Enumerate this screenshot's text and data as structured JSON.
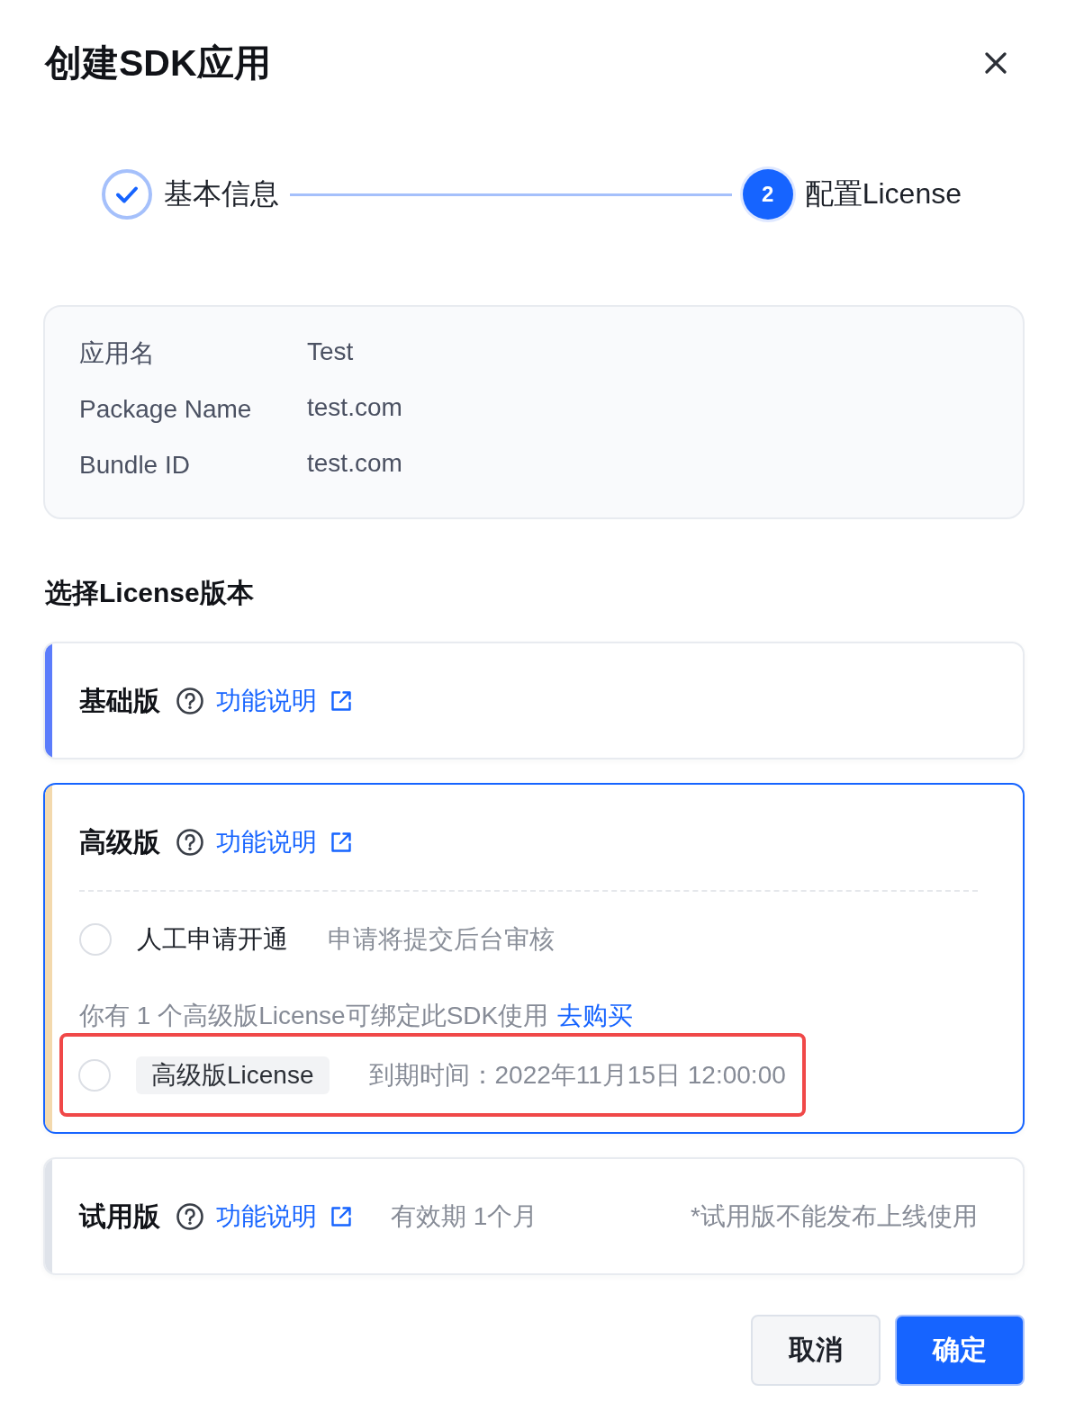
{
  "dialog": {
    "title": "创建SDK应用"
  },
  "steps": [
    {
      "label": "基本信息",
      "completed": true
    },
    {
      "label": "配置License",
      "number": "2",
      "completed": false
    }
  ],
  "app_info": [
    {
      "label": "应用名",
      "value": "Test"
    },
    {
      "label": "Package Name",
      "value": "test.com"
    },
    {
      "label": "Bundle ID",
      "value": "test.com"
    }
  ],
  "license_section": {
    "title": "选择License版本",
    "editions": [
      {
        "name": "基础版",
        "link": "功能说明",
        "color": "#5b7cfb",
        "selected": false
      },
      {
        "name": "高级版",
        "link": "功能说明",
        "color": "#f3d9ad",
        "selected": true,
        "options": [
          {
            "label": "人工申请开通",
            "note": "申请将提交后台审核",
            "selected": false
          }
        ],
        "notice": {
          "text": "你有 1 个高级版License可绑定此SDK使用",
          "link": "去购买"
        },
        "licenses": [
          {
            "tag": "高级版License",
            "expiry": "到期时间：2022年11月15日 12:00:00",
            "selected": false,
            "highlighted": true
          }
        ]
      },
      {
        "name": "试用版",
        "link": "功能说明",
        "color": "#dfe3ea",
        "selected": false,
        "validity": "有效期 1个月",
        "note": "*试用版不能发布上线使用"
      }
    ]
  },
  "buttons": [
    {
      "label": "取消",
      "kind": "secondary"
    },
    {
      "label": "确定",
      "kind": "primary"
    }
  ]
}
